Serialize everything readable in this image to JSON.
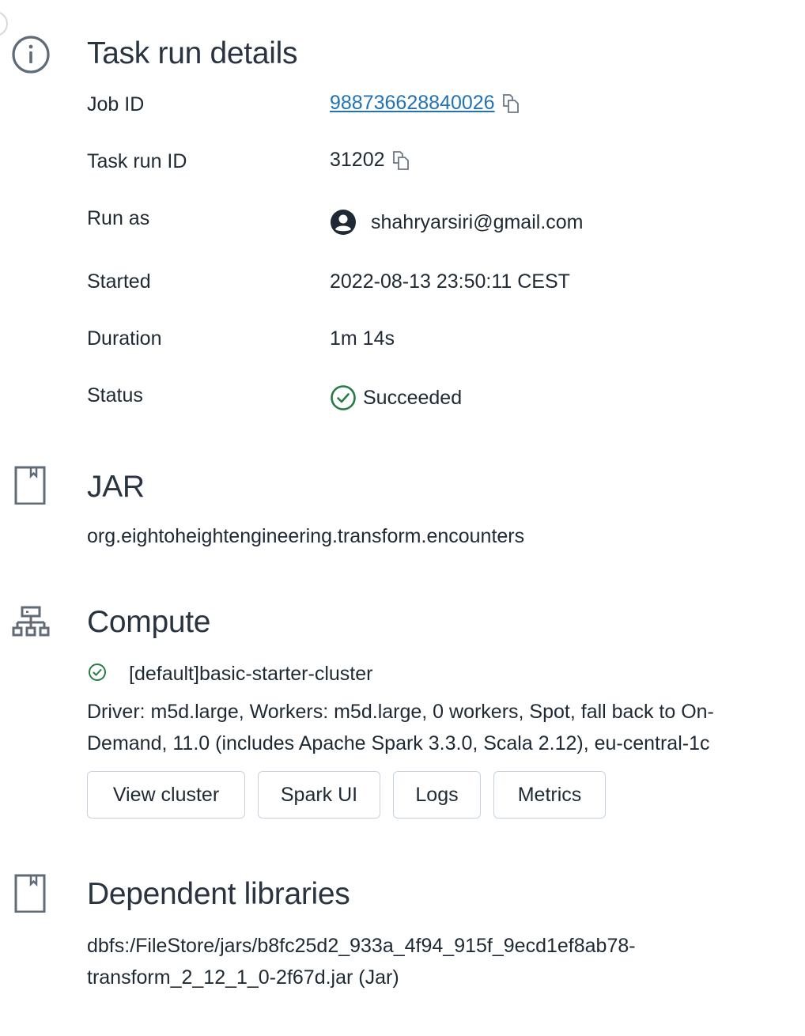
{
  "task_run_details": {
    "title": "Task run details",
    "rows": {
      "job_id": {
        "label": "Job ID",
        "value": "988736628840026"
      },
      "task_run_id": {
        "label": "Task run ID",
        "value": "31202"
      },
      "run_as": {
        "label": "Run as",
        "value": "shahryarsiri@gmail.com"
      },
      "started": {
        "label": "Started",
        "value": "2022-08-13 23:50:11 CEST"
      },
      "duration": {
        "label": "Duration",
        "value": "1m 14s"
      },
      "status": {
        "label": "Status",
        "value": "Succeeded"
      }
    }
  },
  "jar": {
    "title": "JAR",
    "main_class": "org.eightoheightengineering.transform.encounters"
  },
  "compute": {
    "title": "Compute",
    "cluster_name": "[default]basic-starter-cluster",
    "cluster_description": "Driver: m5d.large, Workers: m5d.large, 0 workers, Spot, fall back to On-Demand, 11.0 (includes Apache Spark 3.3.0, Scala 2.12), eu-central-1c",
    "buttons": {
      "view_cluster": "View cluster",
      "spark_ui": "Spark UI",
      "logs": "Logs",
      "metrics": "Metrics"
    }
  },
  "dependent_libraries": {
    "title": "Dependent libraries",
    "items": [
      "dbfs:/FileStore/jars/b8fc25d2_933a_4f94_915f_9ecd1ef8ab78-transform_2_12_1_0-2f67d.jar (Jar)"
    ]
  },
  "colors": {
    "link": "#2272b4",
    "success": "#277c43",
    "icon_gray": "#5f6b77",
    "text": "#1f2933"
  }
}
